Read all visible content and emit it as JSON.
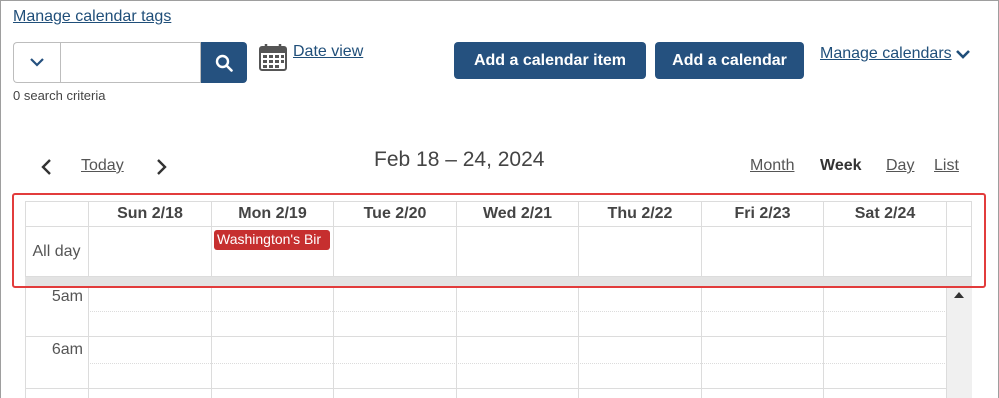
{
  "header": {
    "manage_tags_label": "Manage calendar tags",
    "search": {
      "value": "",
      "placeholder": "",
      "criteria_text": "0 search criteria"
    },
    "date_view_label": "Date view",
    "add_item_label": "Add a calendar item",
    "add_calendar_label": "Add a calendar",
    "manage_calendars_label": "Manage calendars"
  },
  "nav": {
    "today_label": "Today",
    "range_title": "Feb 18 – 24, 2024",
    "views": {
      "month": "Month",
      "week": "Week",
      "day": "Day",
      "list": "List"
    },
    "active_view": "week"
  },
  "calendar": {
    "days": [
      "Sun 2/18",
      "Mon 2/19",
      "Tue 2/20",
      "Wed 2/21",
      "Thu 2/22",
      "Fri 2/23",
      "Sat 2/24"
    ],
    "allday_label": "All day",
    "allday_events": [
      {
        "title": "Washington's Bir",
        "day": "Mon 2/19",
        "color": "#c62f2f"
      }
    ],
    "time_labels": [
      "5am",
      "6am"
    ]
  },
  "colors": {
    "primary_button": "#25517f",
    "link": "#1f4e79",
    "event": "#c62f2f",
    "highlight": "#e23c3c"
  }
}
